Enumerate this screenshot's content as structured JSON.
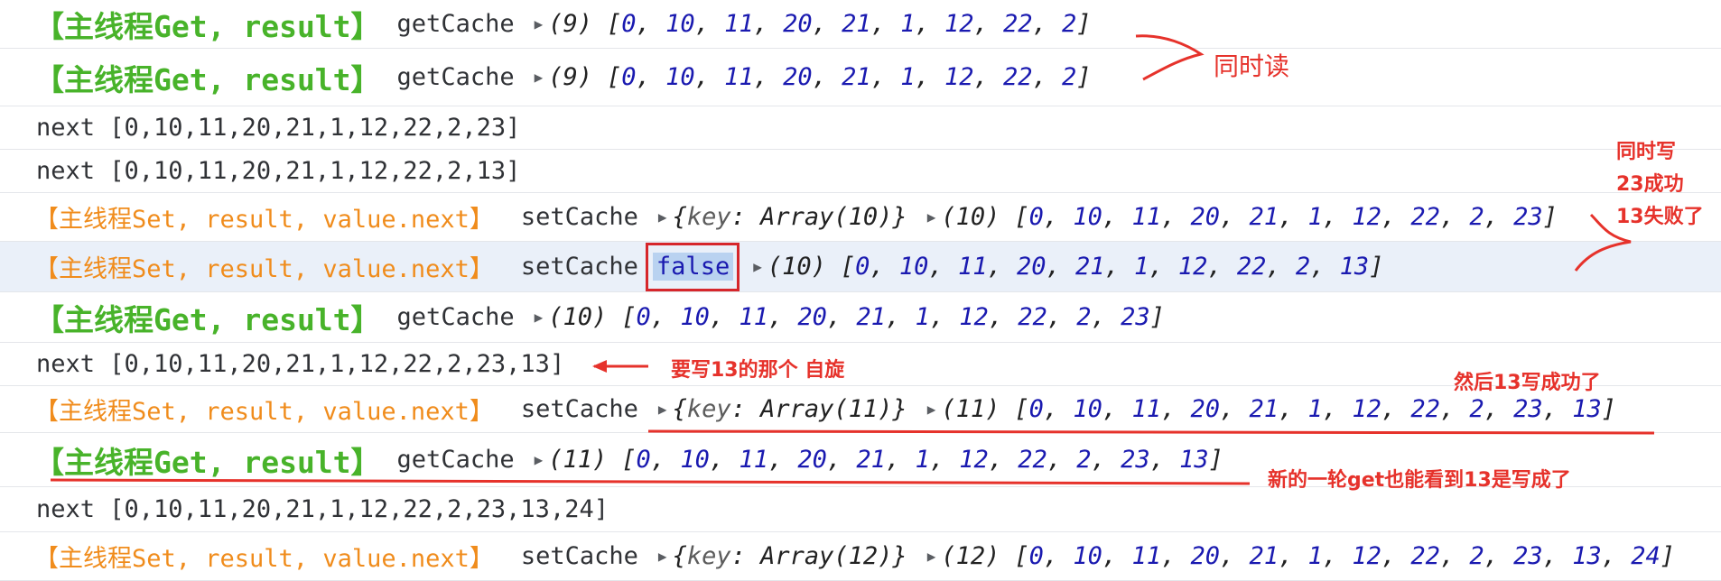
{
  "rows": [
    {
      "type": "get",
      "tag": "【主线程Get, result】",
      "fn": "getCache",
      "meta": "(9)",
      "arr": "[0, 10, 11, 20, 21, 1, 12, 22, 2]"
    },
    {
      "type": "get",
      "tag": "【主线程Get, result】",
      "fn": "getCache",
      "meta": "(9)",
      "arr": "[0, 10, 11, 20, 21, 1, 12, 22, 2]"
    },
    {
      "type": "plain",
      "text": "next [0,10,11,20,21,1,12,22,2,23]"
    },
    {
      "type": "plain",
      "text": "next [0,10,11,20,21,1,12,22,2,13]"
    },
    {
      "type": "set",
      "tag": "【主线程Set, result, value.next】",
      "fn": "setCache",
      "obj": "{key: Array(10)}",
      "meta": "(10)",
      "arr": "[0, 10, 11, 20, 21, 1, 12, 22, 2, 23]"
    },
    {
      "type": "setbool",
      "tag": "【主线程Set, result, value.next】",
      "fn": "setCache",
      "bool": "false",
      "meta": "(10)",
      "arr": "[0, 10, 11, 20, 21, 1, 12, 22, 2, 13]"
    },
    {
      "type": "get",
      "tag": "【主线程Get, result】",
      "fn": "getCache",
      "meta": "(10)",
      "arr": "[0, 10, 11, 20, 21, 1, 12, 22, 2, 23]"
    },
    {
      "type": "plain",
      "text": "next [0,10,11,20,21,1,12,22,2,23,13]"
    },
    {
      "type": "set",
      "tag": "【主线程Set, result, value.next】",
      "fn": "setCache",
      "obj": "{key: Array(11)}",
      "meta": "(11)",
      "arr": "[0, 10, 11, 20, 21, 1, 12, 22, 2, 23, 13]"
    },
    {
      "type": "get",
      "tag": "【主线程Get, result】",
      "fn": "getCache",
      "meta": "(11)",
      "arr": "[0, 10, 11, 20, 21, 1, 12, 22, 2, 23, 13]"
    },
    {
      "type": "plain",
      "text": "next [0,10,11,20,21,1,12,22,2,23,13,24]"
    },
    {
      "type": "set",
      "tag": "【主线程Set, result, value.next】",
      "fn": "setCache",
      "obj": "{key: Array(12)}",
      "meta": "(12)",
      "arr": "[0, 10, 11, 20, 21, 1, 12, 22, 2, 23, 13, 24]"
    }
  ],
  "annotations": {
    "read_same_time": "同时读",
    "write_same_time": "同时写",
    "write_23_ok": "23成功",
    "write_13_fail": "13失败了",
    "spin_13": "要写13的那个 自旋",
    "then_13_ok": "然后13写成功了",
    "new_round": "新的一轮get也能看到13是写成了"
  },
  "colors": {
    "get_tag": "#48b32a",
    "set_tag": "#f08c1c",
    "number": "#1a1ab0",
    "annotation": "#e6322b",
    "highlight_row": "#eaf0f9"
  }
}
